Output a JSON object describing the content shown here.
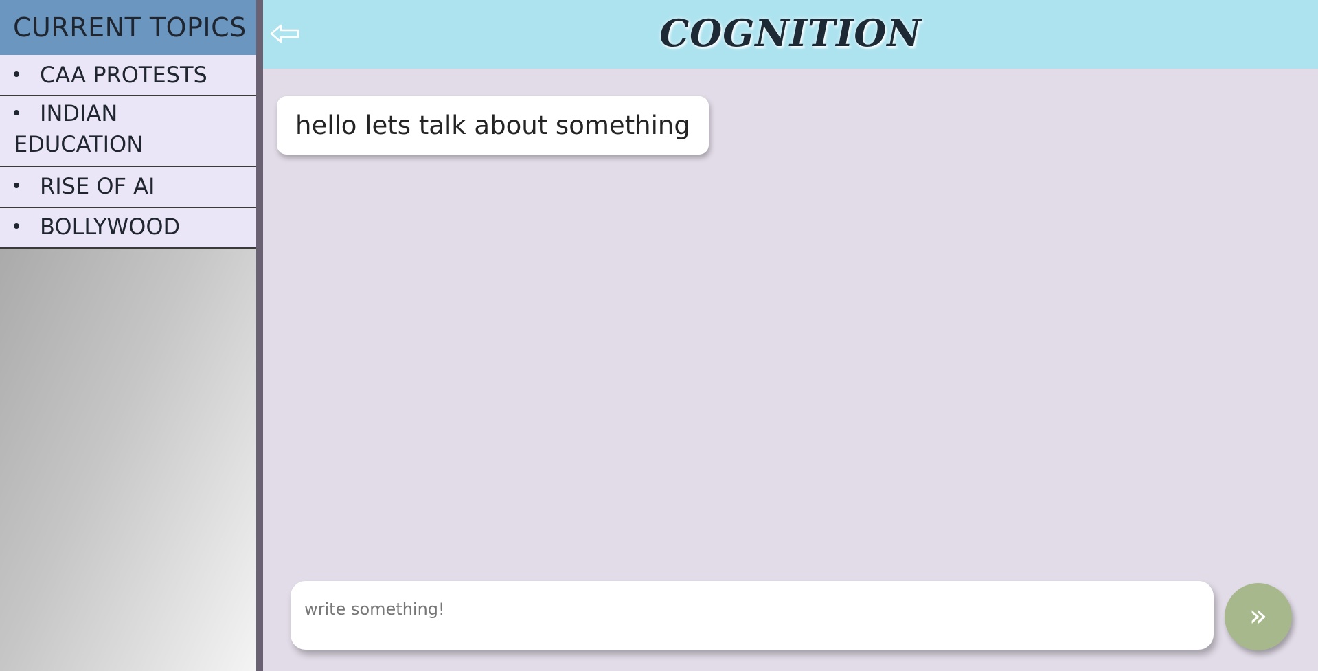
{
  "sidebar": {
    "title": "CURRENT TOPICS",
    "topics": [
      {
        "label": "CAA PROTESTS"
      },
      {
        "label": "INDIAN EDUCATION"
      },
      {
        "label": "RISE OF AI"
      },
      {
        "label": "BOLLYWOOD"
      }
    ]
  },
  "header": {
    "title": "COGNITION",
    "back_icon": "back-arrow-icon",
    "background": "#ade3ef"
  },
  "chat": {
    "messages": [
      {
        "text": "hello lets talk about something"
      }
    ]
  },
  "composer": {
    "placeholder": "write something!",
    "value": "",
    "send_label": "»",
    "send_color": "#a7b98c"
  },
  "colors": {
    "sidebar_header": "#6a96bf",
    "topic_bg": "#ebe6f7",
    "chat_bg": "#e2dce8"
  }
}
